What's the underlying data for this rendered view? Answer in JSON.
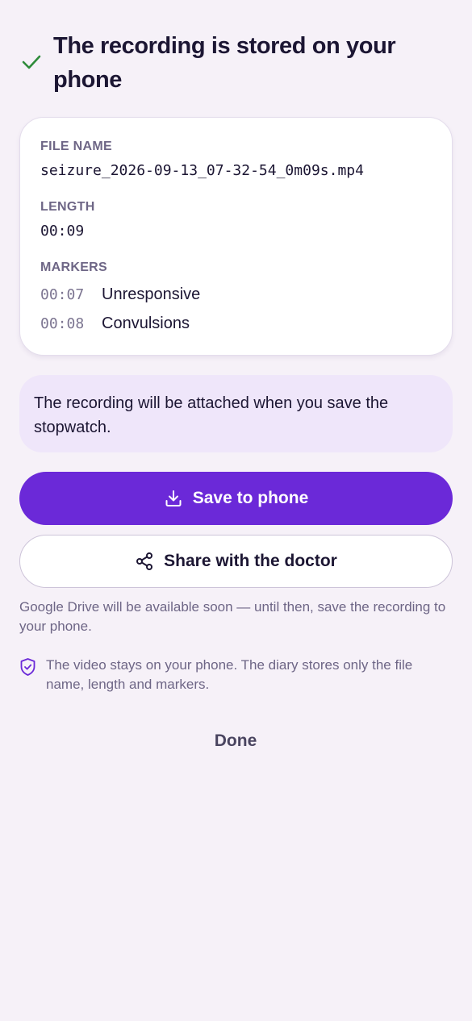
{
  "header": {
    "icon": "check-icon",
    "title": "The recording is stored on your phone"
  },
  "details": {
    "file_name_label": "FILE NAME",
    "file_name": "seizure_2026-09-13_07-32-54_0m09s.mp4",
    "length_label": "LENGTH",
    "length": "00:09",
    "markers_label": "MARKERS",
    "markers": [
      {
        "time": "00:07",
        "label": "Unresponsive"
      },
      {
        "time": "00:08",
        "label": "Convulsions"
      }
    ]
  },
  "notice": {
    "text": "The recording will be attached when you save the stopwatch."
  },
  "actions": {
    "save_label": "Save to phone",
    "save_icon": "download-icon",
    "share_label": "Share with the doctor",
    "share_icon": "share-icon",
    "done_label": "Done"
  },
  "drive_note": "Google Drive will be available soon — until then, save the recording to your phone.",
  "privacy": {
    "icon": "shield-check-icon",
    "text": "The video stays on your phone. The diary stores only the file name, length and markers."
  },
  "colors": {
    "primary": "#6b29d8",
    "success": "#2e8b3a",
    "background": "#f6f1f8",
    "notice_bg": "#efe6fa"
  }
}
